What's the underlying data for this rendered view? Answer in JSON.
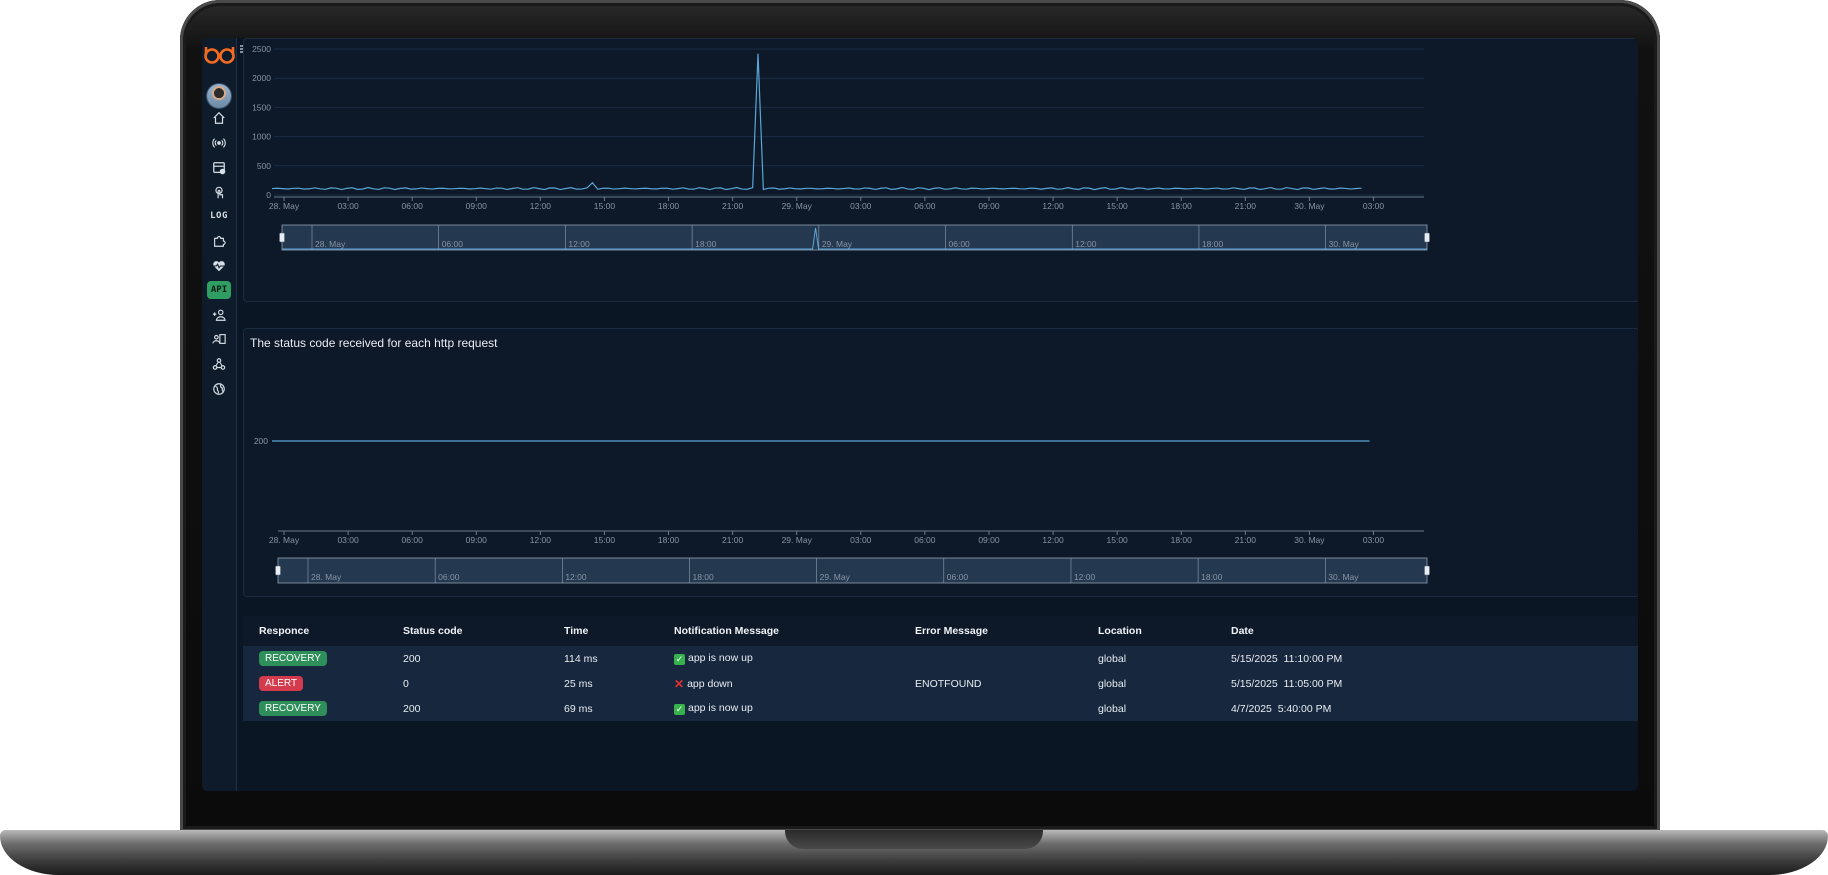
{
  "nav": {
    "log_label": "LOG",
    "api_label": "API",
    "icons": [
      "home-icon",
      "broadcast-icon",
      "dashboard-icon",
      "touch-icon",
      "log-icon",
      "puzzle-icon",
      "heartbeat-icon",
      "api-icon",
      "add-user-icon",
      "contacts-icon",
      "webhook-icon",
      "globe-icon"
    ]
  },
  "chart1": {
    "title": "",
    "yticks": [
      "2500",
      "2000",
      "1500",
      "1000",
      "500",
      "0"
    ],
    "xticks": [
      "28. May",
      "03:00",
      "06:00",
      "09:00",
      "12:00",
      "15:00",
      "18:00",
      "21:00",
      "29. May",
      "03:00",
      "06:00",
      "09:00",
      "12:00",
      "15:00",
      "18:00",
      "21:00",
      "30. May",
      "03:00"
    ],
    "navigator_ticks": [
      "28. May",
      "06:00",
      "12:00",
      "18:00",
      "29. May",
      "06:00",
      "12:00",
      "18:00",
      "30. May"
    ]
  },
  "chart2": {
    "title": "The status code received for each http request",
    "yticks": [
      "200"
    ],
    "xticks": [
      "28. May",
      "03:00",
      "06:00",
      "09:00",
      "12:00",
      "15:00",
      "18:00",
      "21:00",
      "29. May",
      "03:00",
      "06:00",
      "09:00",
      "12:00",
      "15:00",
      "18:00",
      "21:00",
      "30. May",
      "03:00"
    ],
    "navigator_ticks": [
      "28. May",
      "06:00",
      "12:00",
      "18:00",
      "29. May",
      "06:00",
      "12:00",
      "18:00",
      "30. May"
    ]
  },
  "chart_data": [
    {
      "type": "line",
      "title": "",
      "xlabel": "",
      "ylabel": "",
      "ylim": [
        0,
        2500
      ],
      "x": [
        "28. May 00:00",
        "28. May 09:00",
        "28. May 13:30",
        "28. May 15:00",
        "28. May 21:00",
        "28. May 22:45",
        "29. May 00:00",
        "29. May 12:00",
        "29. May 18:00",
        "30. May 03:00"
      ],
      "series": [
        {
          "values": [
            105,
            108,
            110,
            210,
            110,
            2420,
            115,
            115,
            110,
            110
          ]
        }
      ],
      "grid": true,
      "legend": "none"
    },
    {
      "type": "line",
      "title": "The status code received for each http request",
      "xlabel": "",
      "ylabel": "",
      "x": [
        "28. May 00:00",
        "30. May 03:00"
      ],
      "series": [
        {
          "values": [
            200,
            200
          ]
        }
      ],
      "grid": false,
      "legend": "none"
    }
  ],
  "table": {
    "headers": [
      "Responce",
      "Status code",
      "Time",
      "Notification Message",
      "Error Message",
      "Location",
      "Date"
    ],
    "rows": [
      {
        "response": "RECOVERY",
        "status": "200",
        "time": "114 ms",
        "message": "app is now up",
        "error": "",
        "location": "global",
        "date": "5/15/2025  11:10:00 PM"
      },
      {
        "response": "ALERT",
        "status": "0",
        "time": "25 ms",
        "message": "app down",
        "error": "ENOTFOUND",
        "location": "global",
        "date": "5/15/2025  11:05:00 PM"
      },
      {
        "response": "RECOVERY",
        "status": "200",
        "time": "69 ms",
        "message": "app is now up",
        "error": "",
        "location": "global",
        "date": "4/7/2025  5:40:00 PM"
      }
    ]
  },
  "colors": {
    "series": "#5aa6d6",
    "recovery": "#2f8f5b",
    "alert": "#d43c4e",
    "logo": "#f26b21"
  }
}
